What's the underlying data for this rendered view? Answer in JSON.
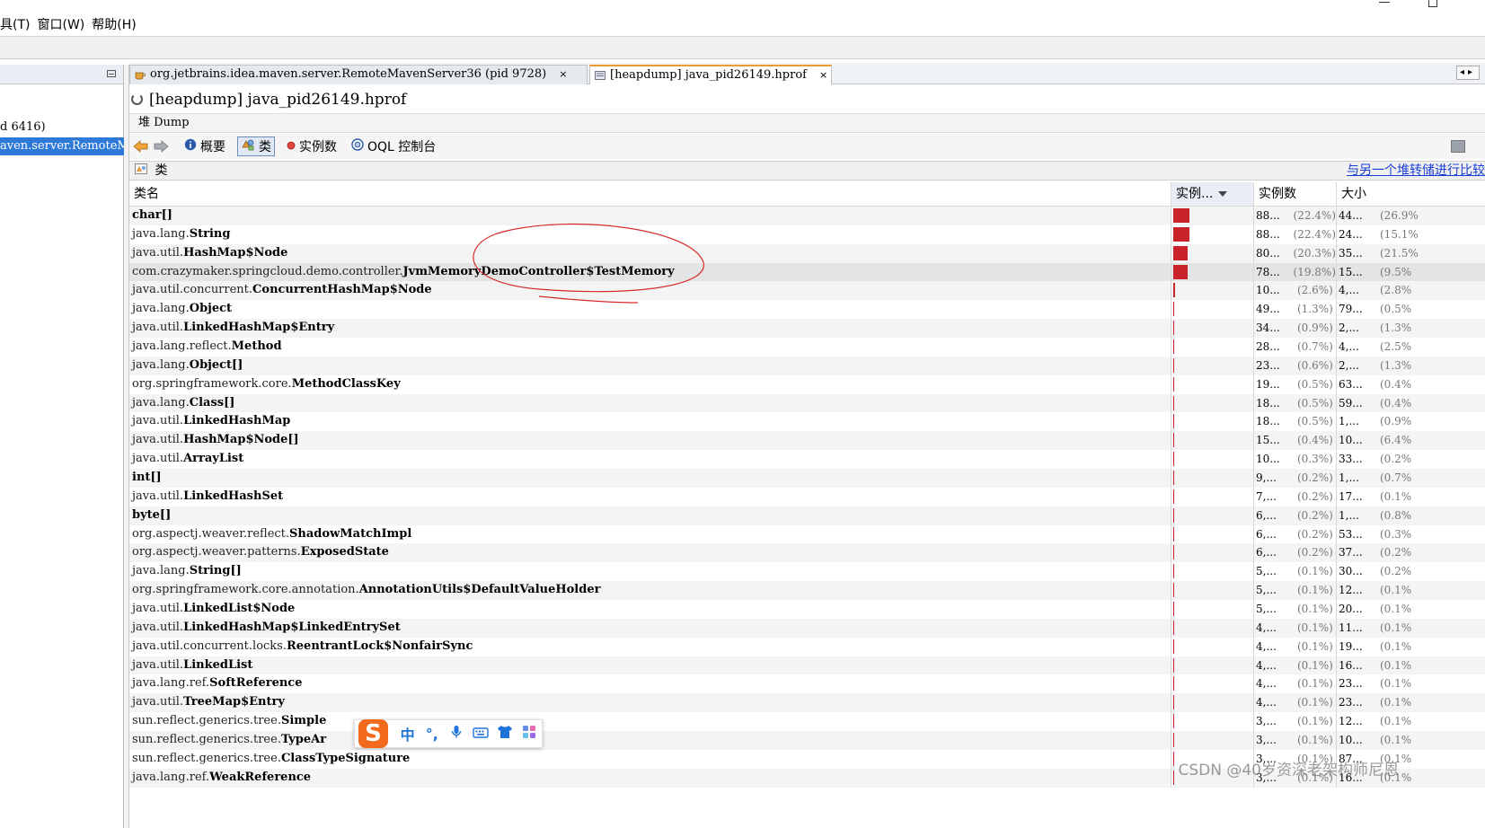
{
  "menubar": {
    "items": [
      "具(T)",
      "窗口(W)",
      "帮助(H)"
    ]
  },
  "left_panel": {
    "items": [
      {
        "label": "d 6416)",
        "selected": false
      },
      {
        "label": "aven.server.RemoteM",
        "selected": true
      }
    ]
  },
  "tabs": [
    {
      "label": "org.jetbrains.idea.maven.server.RemoteMavenServer36 (pid 9728)",
      "close": "×",
      "active": false
    },
    {
      "label": "[heapdump] java_pid26149.hprof",
      "close": "×",
      "active": true
    }
  ],
  "tab_nav": "◂▸",
  "heap": {
    "title": "[heapdump] java_pid26149.hprof",
    "dump_label": "堆 Dump"
  },
  "toolbar": {
    "items": [
      {
        "label": "概要",
        "icon": "info-icon",
        "pressed": false
      },
      {
        "label": "类",
        "icon": "classes-icon",
        "pressed": true
      },
      {
        "label": "实例数",
        "icon": "instances-icon",
        "pressed": false
      },
      {
        "label": "OQL 控制台",
        "icon": "oql-icon",
        "pressed": false
      }
    ]
  },
  "class_section": {
    "header": "类",
    "compare_link": "与另一个堆转储进行比较"
  },
  "table": {
    "columns": {
      "name": "类名",
      "bar": "实例...",
      "count": "实例数",
      "size": "大小"
    },
    "rows": [
      {
        "pkg": "",
        "cls": "char[]",
        "bar": 22.4,
        "count": "88...",
        "count_pct": "(22.4%)",
        "size": "44...",
        "size_pct": "(26.9%"
      },
      {
        "pkg": "java.lang.",
        "cls": "String",
        "bar": 22.4,
        "count": "88...",
        "count_pct": "(22.4%)",
        "size": "24...",
        "size_pct": "(15.1%"
      },
      {
        "pkg": "java.util.",
        "cls": "HashMap$Node",
        "bar": 20.3,
        "count": "80...",
        "count_pct": "(20.3%)",
        "size": "35...",
        "size_pct": "(21.5%"
      },
      {
        "pkg": "com.crazymaker.springcloud.demo.controller.",
        "cls": "JvmMemoryDemoController$TestMemory",
        "bar": 19.8,
        "count": "78...",
        "count_pct": "(19.8%)",
        "size": "15...",
        "size_pct": "(9.5%"
      },
      {
        "pkg": "java.util.concurrent.",
        "cls": "ConcurrentHashMap$Node",
        "bar": 2.6,
        "count": "10...",
        "count_pct": "(2.6%)",
        "size": "4,...",
        "size_pct": "(2.8%"
      },
      {
        "pkg": "java.lang.",
        "cls": "Object",
        "bar": 1.3,
        "count": "49...",
        "count_pct": "(1.3%)",
        "size": "79...",
        "size_pct": "(0.5%"
      },
      {
        "pkg": "java.util.",
        "cls": "LinkedHashMap$Entry",
        "bar": 0.9,
        "count": "34...",
        "count_pct": "(0.9%)",
        "size": "2,...",
        "size_pct": "(1.3%"
      },
      {
        "pkg": "java.lang.reflect.",
        "cls": "Method",
        "bar": 0.7,
        "count": "28...",
        "count_pct": "(0.7%)",
        "size": "4,...",
        "size_pct": "(2.5%"
      },
      {
        "pkg": "java.lang.",
        "cls": "Object[]",
        "bar": 0.6,
        "count": "23...",
        "count_pct": "(0.6%)",
        "size": "2,...",
        "size_pct": "(1.3%"
      },
      {
        "pkg": "org.springframework.core.",
        "cls": "MethodClassKey",
        "bar": 0.5,
        "count": "19...",
        "count_pct": "(0.5%)",
        "size": "63...",
        "size_pct": "(0.4%"
      },
      {
        "pkg": "java.lang.",
        "cls": "Class[]",
        "bar": 0.5,
        "count": "18...",
        "count_pct": "(0.5%)",
        "size": "59...",
        "size_pct": "(0.4%"
      },
      {
        "pkg": "java.util.",
        "cls": "LinkedHashMap",
        "bar": 0.5,
        "count": "18...",
        "count_pct": "(0.5%)",
        "size": "1,...",
        "size_pct": "(0.9%"
      },
      {
        "pkg": "java.util.",
        "cls": "HashMap$Node[]",
        "bar": 0.4,
        "count": "15...",
        "count_pct": "(0.4%)",
        "size": "10...",
        "size_pct": "(6.4%"
      },
      {
        "pkg": "java.util.",
        "cls": "ArrayList",
        "bar": 0.3,
        "count": "10...",
        "count_pct": "(0.3%)",
        "size": "33...",
        "size_pct": "(0.2%"
      },
      {
        "pkg": "",
        "cls": "int[]",
        "bar": 0.2,
        "count": "9,...",
        "count_pct": "(0.2%)",
        "size": "1,...",
        "size_pct": "(0.7%"
      },
      {
        "pkg": "java.util.",
        "cls": "LinkedHashSet",
        "bar": 0.2,
        "count": "7,...",
        "count_pct": "(0.2%)",
        "size": "17...",
        "size_pct": "(0.1%"
      },
      {
        "pkg": "",
        "cls": "byte[]",
        "bar": 0.2,
        "count": "6,...",
        "count_pct": "(0.2%)",
        "size": "1,...",
        "size_pct": "(0.8%"
      },
      {
        "pkg": "org.aspectj.weaver.reflect.",
        "cls": "ShadowMatchImpl",
        "bar": 0.2,
        "count": "6,...",
        "count_pct": "(0.2%)",
        "size": "53...",
        "size_pct": "(0.3%"
      },
      {
        "pkg": "org.aspectj.weaver.patterns.",
        "cls": "ExposedState",
        "bar": 0.2,
        "count": "6,...",
        "count_pct": "(0.2%)",
        "size": "37...",
        "size_pct": "(0.2%"
      },
      {
        "pkg": "java.lang.",
        "cls": "String[]",
        "bar": 0.1,
        "count": "5,...",
        "count_pct": "(0.1%)",
        "size": "30...",
        "size_pct": "(0.2%"
      },
      {
        "pkg": "org.springframework.core.annotation.",
        "cls": "AnnotationUtils$DefaultValueHolder",
        "bar": 0.1,
        "count": "5,...",
        "count_pct": "(0.1%)",
        "size": "12...",
        "size_pct": "(0.1%"
      },
      {
        "pkg": "java.util.",
        "cls": "LinkedList$Node",
        "bar": 0.1,
        "count": "5,...",
        "count_pct": "(0.1%)",
        "size": "20...",
        "size_pct": "(0.1%"
      },
      {
        "pkg": "java.util.",
        "cls": "LinkedHashMap$LinkedEntrySet",
        "bar": 0.1,
        "count": "4,...",
        "count_pct": "(0.1%)",
        "size": "11...",
        "size_pct": "(0.1%"
      },
      {
        "pkg": "java.util.concurrent.locks.",
        "cls": "ReentrantLock$NonfairSync",
        "bar": 0.1,
        "count": "4,...",
        "count_pct": "(0.1%)",
        "size": "19...",
        "size_pct": "(0.1%"
      },
      {
        "pkg": "java.util.",
        "cls": "LinkedList",
        "bar": 0.1,
        "count": "4,...",
        "count_pct": "(0.1%)",
        "size": "16...",
        "size_pct": "(0.1%"
      },
      {
        "pkg": "java.lang.ref.",
        "cls": "SoftReference",
        "bar": 0.1,
        "count": "4,...",
        "count_pct": "(0.1%)",
        "size": "23...",
        "size_pct": "(0.1%"
      },
      {
        "pkg": "java.util.",
        "cls": "TreeMap$Entry",
        "bar": 0.1,
        "count": "4,...",
        "count_pct": "(0.1%)",
        "size": "23...",
        "size_pct": "(0.1%"
      },
      {
        "pkg": "sun.reflect.generics.tree.",
        "cls": "Simple",
        "bar": 0.1,
        "count": "3,...",
        "count_pct": "(0.1%)",
        "size": "12...",
        "size_pct": "(0.1%"
      },
      {
        "pkg": "sun.reflect.generics.tree.",
        "cls": "TypeAr",
        "bar": 0.1,
        "count": "3,...",
        "count_pct": "(0.1%)",
        "size": "10...",
        "size_pct": "(0.1%"
      },
      {
        "pkg": "sun.reflect.generics.tree.",
        "cls": "ClassTypeSignature",
        "bar": 0.1,
        "count": "3,...",
        "count_pct": "(0.1%)",
        "size": "87...",
        "size_pct": "(0.1%"
      },
      {
        "pkg": "java.lang.ref.",
        "cls": "WeakReference",
        "bar": 0.1,
        "count": "3,...",
        "count_pct": "(0.1%)",
        "size": "16...",
        "size_pct": "(0.1%"
      }
    ]
  },
  "ime": {
    "logo": "S",
    "buttons": [
      "中",
      "°,",
      "🎤",
      "⌨",
      "👕",
      "▦"
    ]
  },
  "watermark": "CSDN @40岁资深老架构师尼恩",
  "colors": {
    "bar": "#c8232a",
    "selection": "#2f7ad8",
    "link": "#1a3fd6",
    "active_tab_accent": "#ef9a2c",
    "annotation": "#d62a2a"
  }
}
